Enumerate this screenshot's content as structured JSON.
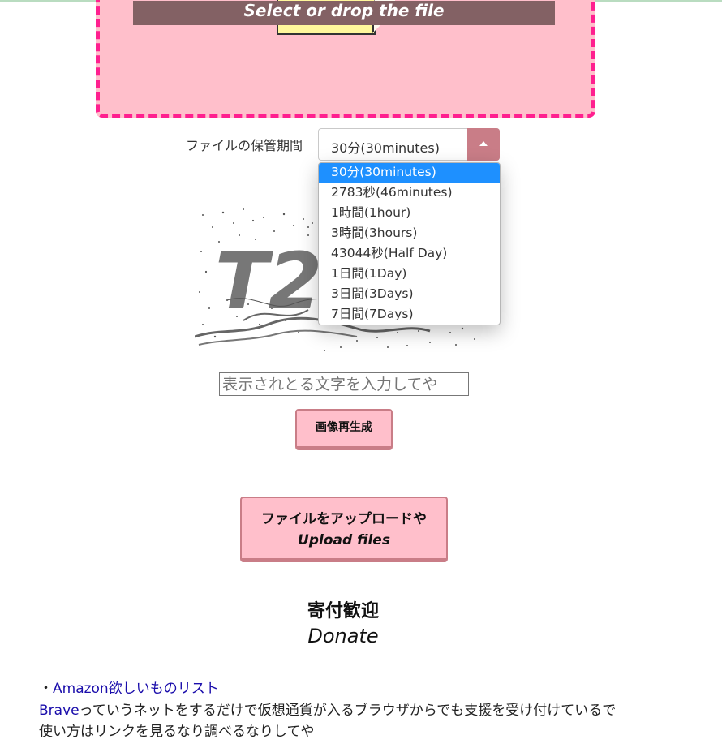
{
  "dropzone": {
    "banner_text": "Select or drop the file"
  },
  "retention": {
    "label": "ファイルの保管期間",
    "selected": "30分(30minutes)",
    "options": [
      "30分(30minutes)",
      "2783秒(46minutes)",
      "1時間(1hour)",
      "3時間(3hours)",
      "43044秒(Half Day)",
      "1日間(1Day)",
      "3日間(3Days)",
      "7日間(7Days)"
    ]
  },
  "captcha": {
    "image_text": "T2",
    "input_placeholder": "表示されとる文字を入力してや",
    "regenerate_label": "画像再生成"
  },
  "upload": {
    "label_ja": "ファイルをアップロードや",
    "label_en": "Upload files"
  },
  "donate": {
    "title": "寄付歓迎",
    "subtitle": "Donate",
    "bullet": "・",
    "amazon_link": "Amazon欲しいものリスト",
    "brave_link": "Brave",
    "brave_text": "っていうネットをするだけで仮想通貨が入るブラウザからでも支援を受け付けているで",
    "usage_text": "使い方はリンクを見るなり調べるなりしてや"
  },
  "colors": {
    "dropzone_bg": "#ffbfcb",
    "dropzone_border": "#ff1f8f",
    "button_bg": "#ffbfcb",
    "button_border": "#c97d87",
    "dropdown_highlight": "#1e90ff"
  }
}
